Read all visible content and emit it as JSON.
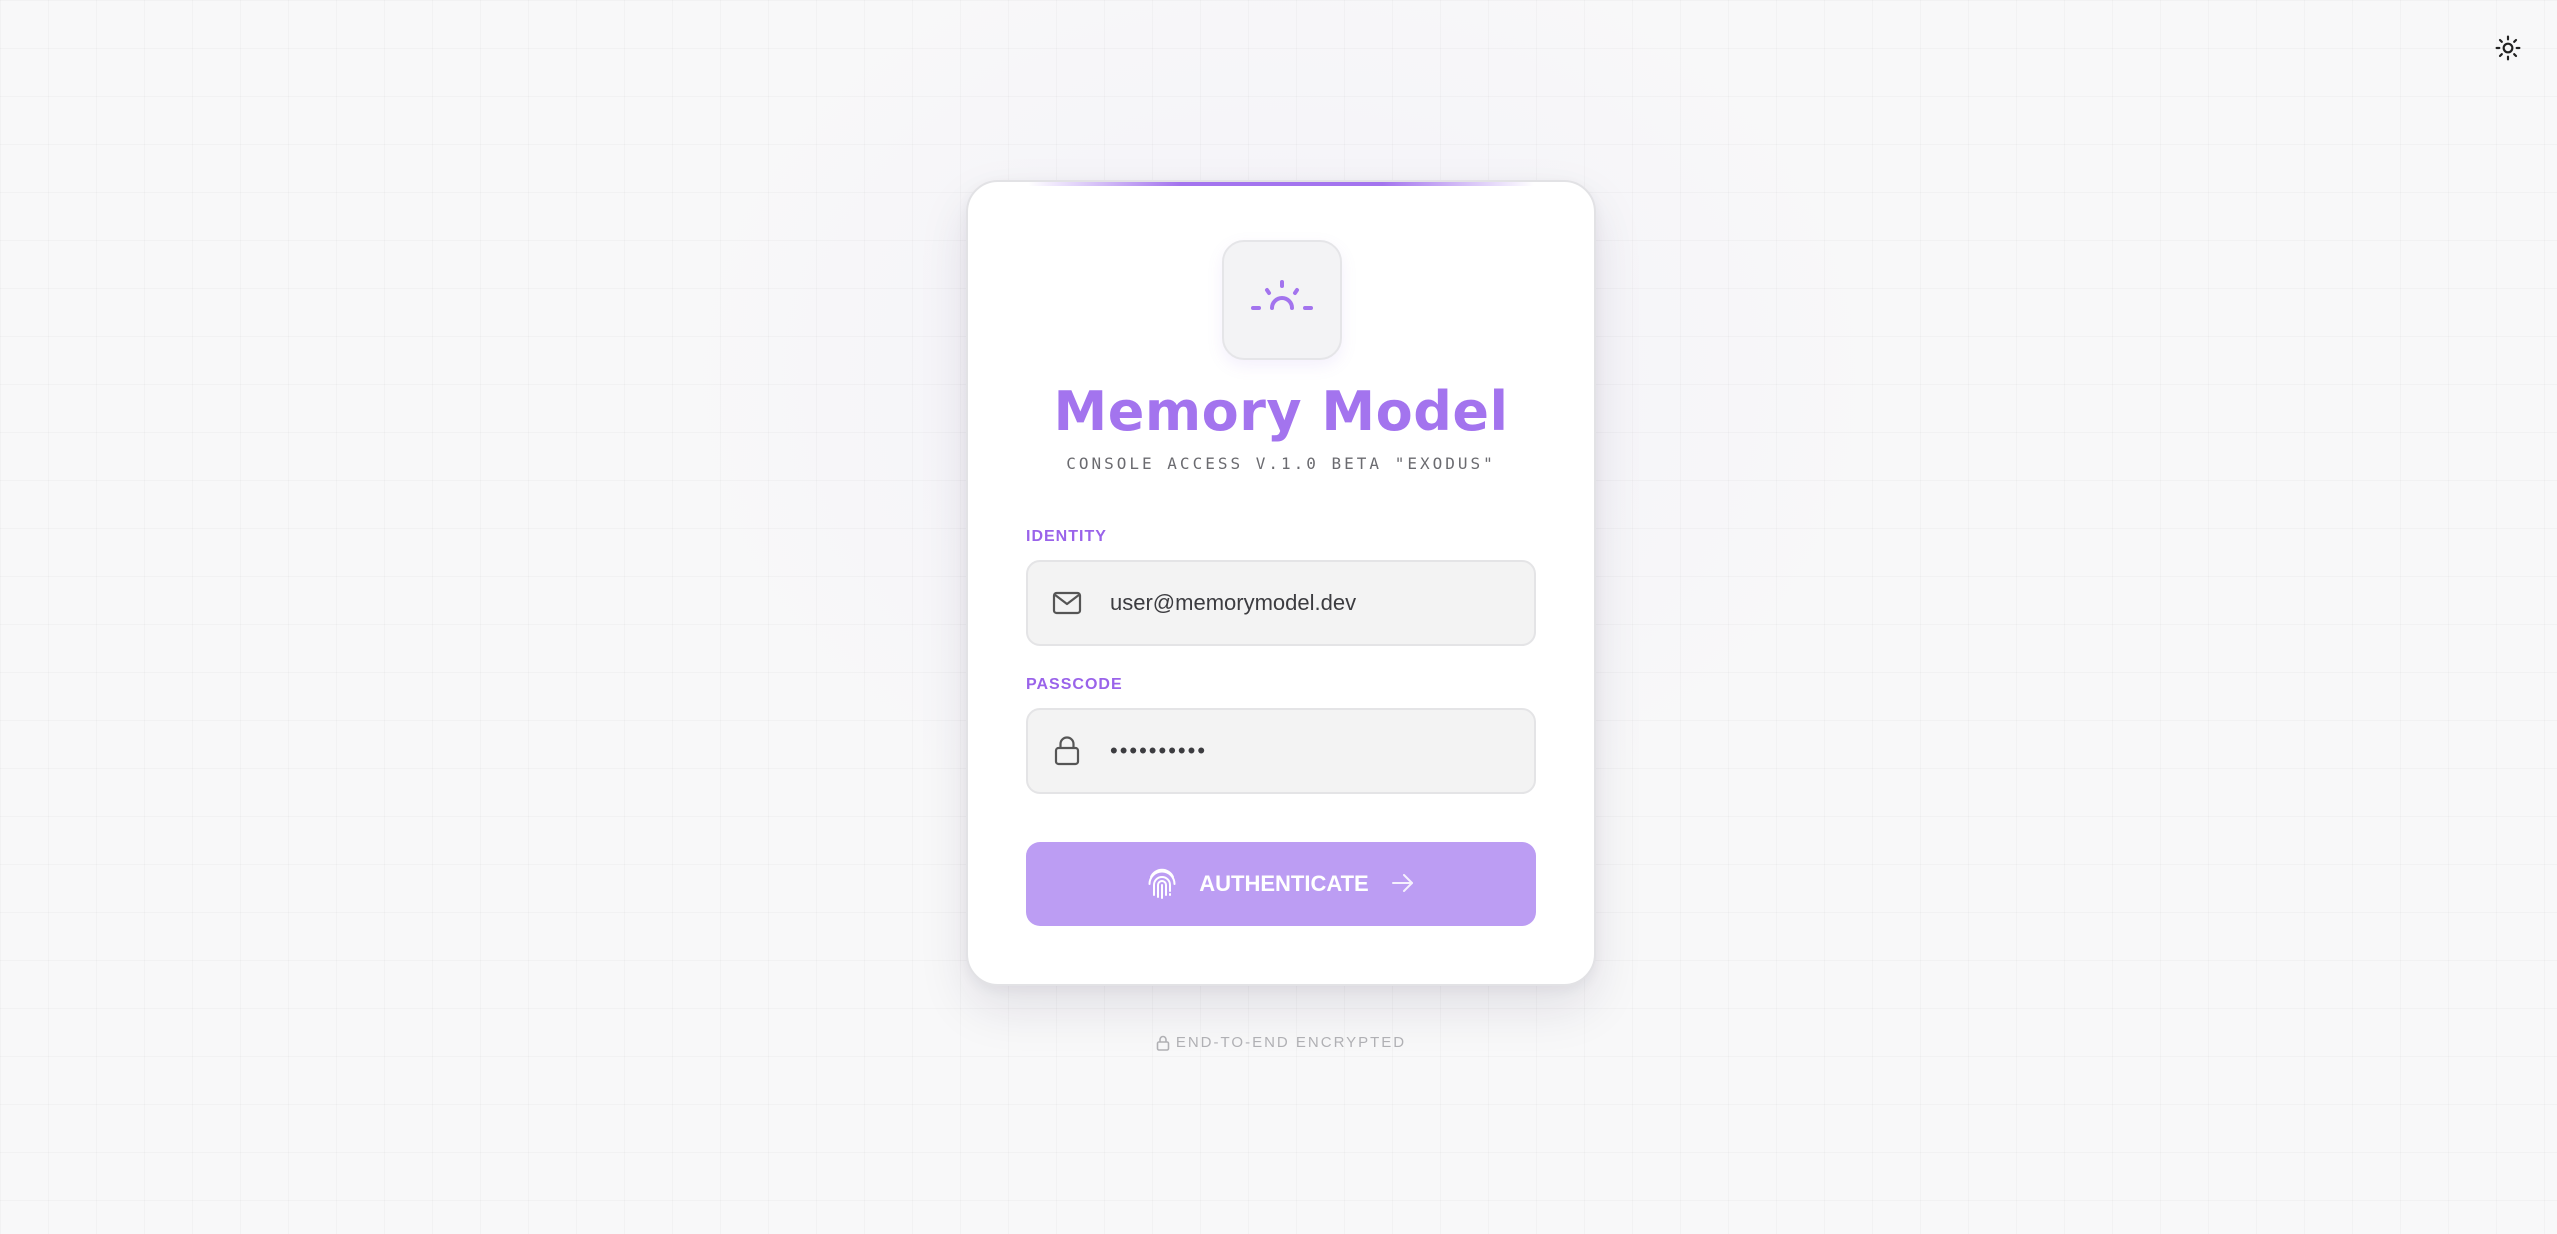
{
  "app": {
    "title": "Memory Model",
    "subtitle": "CONSOLE ACCESS V.1.0 BETA \"EXODUS\""
  },
  "header": {
    "theme_toggle_icon": "sun-icon"
  },
  "logo": {
    "icon": "sunrise-icon"
  },
  "form": {
    "identity": {
      "label": "IDENTITY",
      "value": "user@memorymodel.dev",
      "icon": "mail-icon"
    },
    "passcode": {
      "label": "PASSCODE",
      "value": "••••••••••",
      "icon": "lock-icon"
    },
    "submit": {
      "label": "AUTHENTICATE",
      "leading_icon": "fingerprint-icon",
      "trailing_icon": "arrow-right-icon"
    }
  },
  "footer": {
    "note": "END-TO-END ENCRYPTED",
    "icon": "lock-icon"
  },
  "colors": {
    "accent": "#a374ee",
    "button": "#bc9df3",
    "label": "#9a63ea",
    "background": "#f8f8f9"
  }
}
